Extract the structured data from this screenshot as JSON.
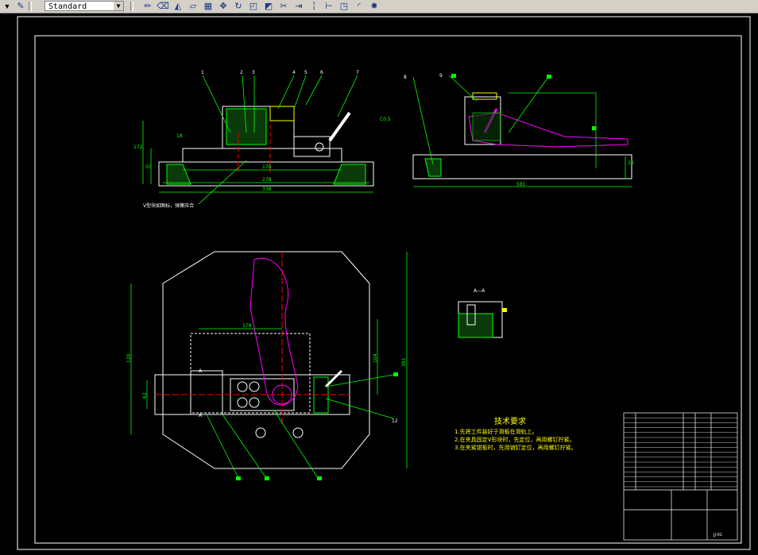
{
  "toolbar": {
    "style_combo_value": "Standard",
    "icons": [
      "pencil-icon",
      "erase-icon",
      "mirror-icon",
      "offset-icon",
      "array-icon",
      "move-icon",
      "rotate-icon",
      "scale-icon",
      "stretch-icon",
      "trim-icon",
      "extend-icon",
      "break-icon",
      "join-icon",
      "chamfer-icon",
      "fillet-icon",
      "explode-icon"
    ]
  },
  "drawing": {
    "colors": {
      "frame": "#ffffff",
      "geometry": "#ffffff",
      "dimension": "#00ff00",
      "part": "#ff00ff",
      "hatch": "#00ff00",
      "center": "#ff0000",
      "label": "#ffff00"
    },
    "front_view": {
      "dims": {
        "d1": "178",
        "d2": "278",
        "d3": "338",
        "h1": "172",
        "h2": "50",
        "h3": "18"
      },
      "balloons": [
        "1",
        "2",
        "3",
        "4",
        "5",
        "6",
        "7"
      ],
      "note": "V型块如图标，弹簧压合"
    },
    "side_view": {
      "dims": {
        "w": "581",
        "h": "35",
        "t": "C0.5"
      },
      "balloons": [
        "8",
        "9",
        "10",
        "11"
      ]
    },
    "plan_view": {
      "dims": {
        "a": "178",
        "b": "104",
        "c": "120",
        "d": "381",
        "e": "62"
      },
      "balloons": [
        "12",
        "13",
        "14",
        "15",
        "16"
      ],
      "markers": [
        "A",
        "A"
      ]
    },
    "section": {
      "title": "A—A"
    },
    "tech_req": {
      "title": "技术要求",
      "lines": [
        "1.先将工件装好于滑板在滑轨上。",
        "2.在夹具固定V形块时，先定位，再用螺钉拧紧。",
        "3.在夹紧钳板时，先用销钉定位，再用螺钉拧紧。"
      ]
    },
    "title_block": {
      "code": "JJ-01"
    }
  }
}
